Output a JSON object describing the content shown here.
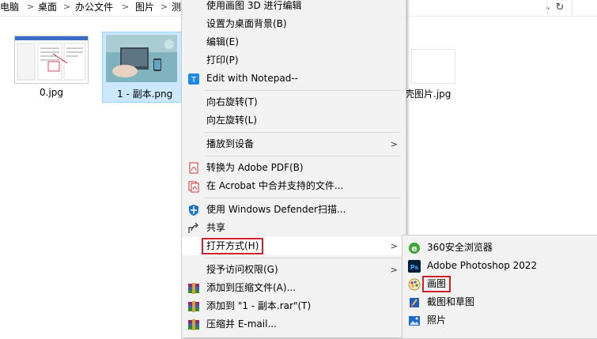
{
  "breadcrumb": [
    "电脑",
    "桌面",
    "办公文件",
    "图片",
    "测"
  ],
  "files": [
    {
      "name": "0.jpg"
    },
    {
      "name": "1 - 副本.png"
    },
    {
      "name": "壳图片.jpg"
    }
  ],
  "context_menu": {
    "items": [
      {
        "label": "使用画图 3D 进行编辑",
        "icon": "none"
      },
      {
        "label": "设置为桌面背景(B)",
        "icon": "none"
      },
      {
        "label": "编辑(E)",
        "icon": "none"
      },
      {
        "label": "打印(P)",
        "icon": "none"
      },
      {
        "label": "Edit with Notepad--",
        "icon": "notepad-icon"
      },
      {
        "label": "向右旋转(T)",
        "icon": "none"
      },
      {
        "label": "向左旋转(L)",
        "icon": "none"
      },
      {
        "label": "播放到设备",
        "icon": "none"
      },
      {
        "label": "转换为 Adobe PDF(B)",
        "icon": "pdf-icon"
      },
      {
        "label": "在 Acrobat 中合并支持的文件...",
        "icon": "acrobat-icon"
      },
      {
        "label": "使用 Windows Defender扫描...",
        "icon": "defender-icon"
      },
      {
        "label": "共享",
        "icon": "share-icon"
      },
      {
        "label": "打开方式(H)",
        "icon": "none"
      },
      {
        "label": "授予访问权限(G)",
        "icon": "none"
      },
      {
        "label": "添加到压缩文件(A)...",
        "icon": "winrar-icon"
      },
      {
        "label": "添加到 \"1 - 副本.rar\"(T)",
        "icon": "winrar-icon"
      },
      {
        "label": "压缩并 E-mail...",
        "icon": "winrar-icon"
      }
    ]
  },
  "submenu": {
    "items": [
      {
        "label": "360安全浏览器",
        "icon": "360-browser-icon"
      },
      {
        "label": "Adobe Photoshop 2022",
        "icon": "photoshop-icon"
      },
      {
        "label": "画图",
        "icon": "paint-icon"
      },
      {
        "label": "截图和草图",
        "icon": "snip-sketch-icon"
      },
      {
        "label": "照片",
        "icon": "photos-icon"
      }
    ]
  },
  "colors": {
    "highlight_border": "#d0202a",
    "menu_bg": "#f2f2f2",
    "selection": "#cce8ff"
  }
}
